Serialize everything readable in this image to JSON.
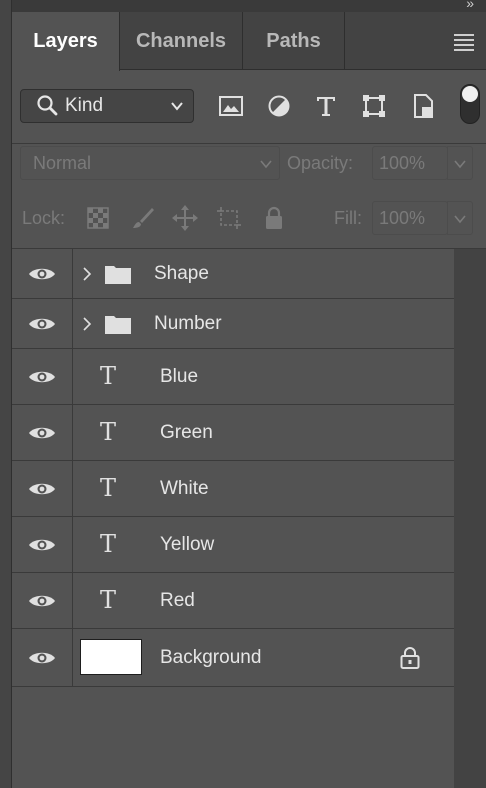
{
  "tabs": [
    {
      "label": "Layers",
      "active": true
    },
    {
      "label": "Channels",
      "active": false
    },
    {
      "label": "Paths",
      "active": false
    }
  ],
  "filter": {
    "kind_label": "Kind",
    "icons": [
      "image-filter-icon",
      "adjustment-filter-icon",
      "type-filter-icon",
      "shape-filter-icon",
      "smart-object-filter-icon"
    ]
  },
  "blend": {
    "mode": "Normal",
    "opacity_label": "Opacity:",
    "opacity_value": "100%"
  },
  "lock": {
    "label": "Lock:",
    "icons": [
      "lock-transparent-pixels-icon",
      "lock-image-pixels-icon",
      "lock-position-icon",
      "prevent-auto-nesting-icon",
      "lock-all-icon"
    ],
    "fill_label": "Fill:",
    "fill_value": "100%"
  },
  "layers": [
    {
      "name": "Shape",
      "type": "group"
    },
    {
      "name": "Number",
      "type": "group"
    },
    {
      "name": "Blue",
      "type": "text"
    },
    {
      "name": "Green",
      "type": "text"
    },
    {
      "name": "White",
      "type": "text"
    },
    {
      "name": "Yellow",
      "type": "text"
    },
    {
      "name": "Red",
      "type": "text"
    },
    {
      "name": "Background",
      "type": "background",
      "thumb_color": "#ffffff",
      "locked": true
    }
  ],
  "colors": {
    "panel_bg": "#535353",
    "tab_bar_bg": "#434343",
    "text": "#e6e6e6",
    "dim_text": "#7a7a7a"
  }
}
